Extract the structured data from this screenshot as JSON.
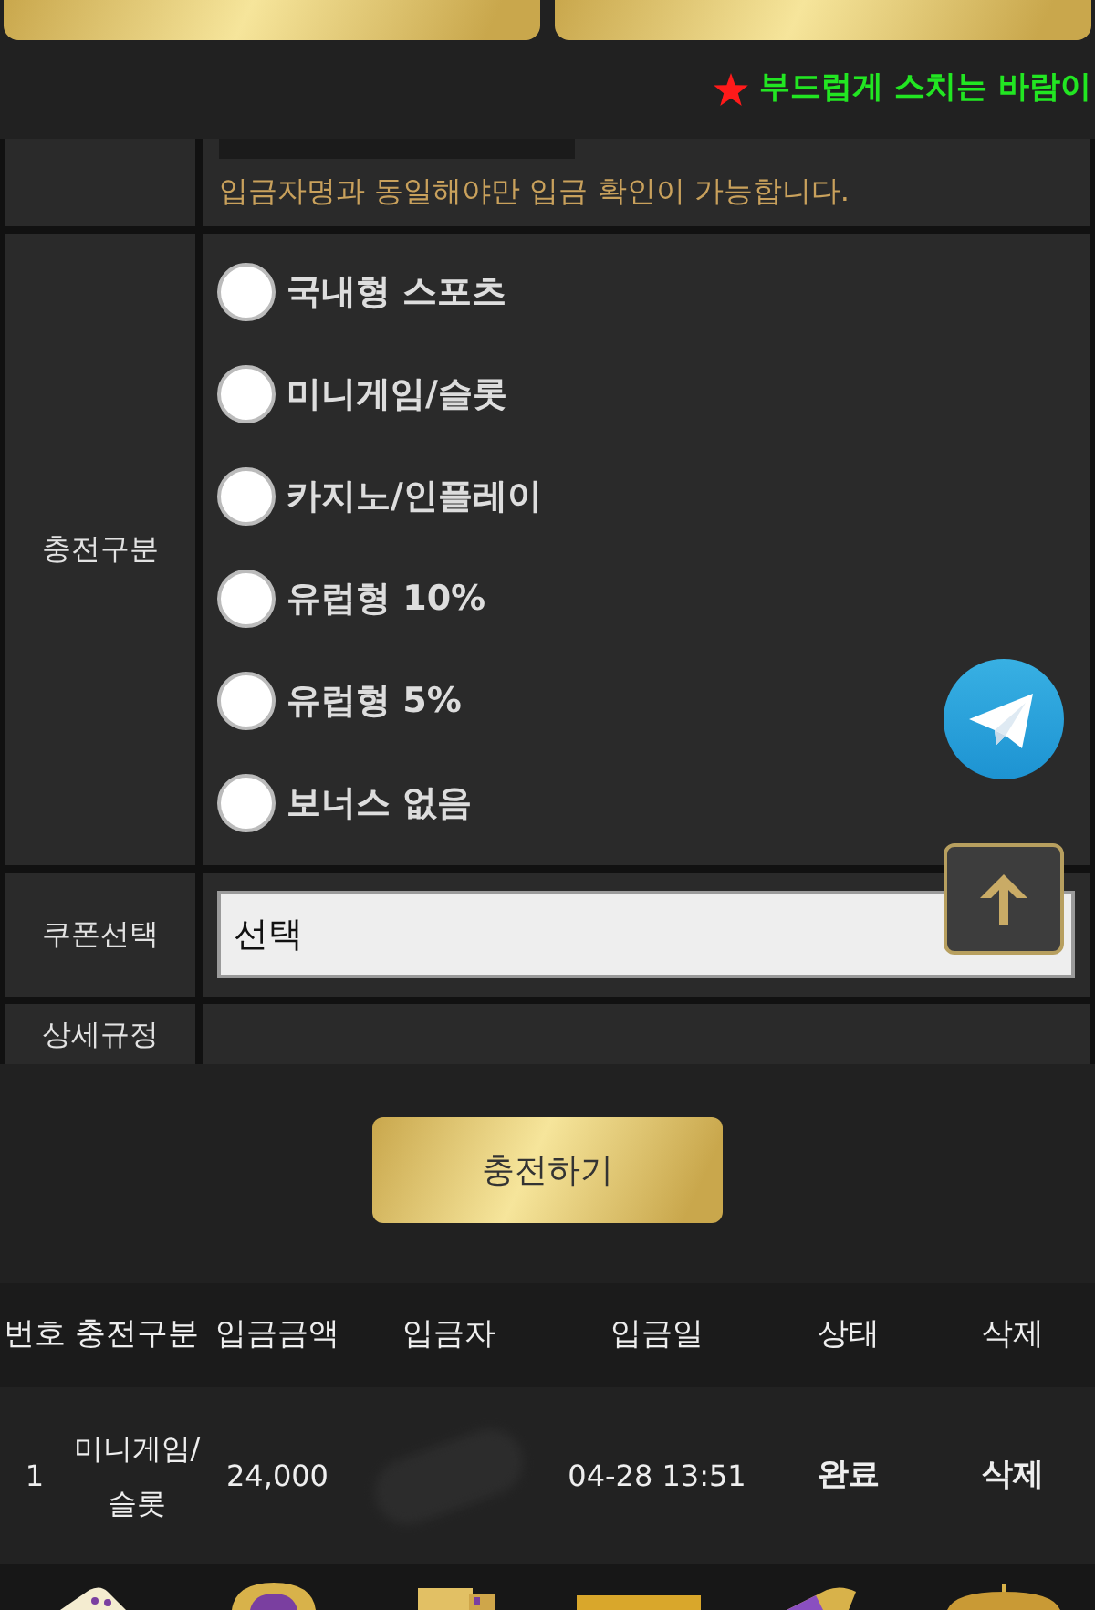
{
  "notice": {
    "text": "부드럽게 스치는 바람이"
  },
  "form": {
    "rows": [
      {
        "kind": "note",
        "note": "입금자명과 동일해야만 입금 확인이 가능합니다."
      },
      {
        "kind": "radio",
        "label": "충전구분",
        "options": [
          {
            "label": "국내형 스포츠",
            "selected": false
          },
          {
            "label": "미니게임/슬롯",
            "selected": false
          },
          {
            "label": "카지노/인플레이",
            "selected": false
          },
          {
            "label": "유럽형 10%",
            "selected": false
          },
          {
            "label": "유럽형 5%",
            "selected": false
          },
          {
            "label": "보너스 없음",
            "selected": false
          }
        ]
      },
      {
        "kind": "select",
        "label": "쿠폰선택",
        "value": "선택"
      },
      {
        "kind": "text",
        "label": "상세규정"
      }
    ]
  },
  "submit_button": {
    "label": "충전하기"
  },
  "history": {
    "columns": [
      "번호",
      "충전구분",
      "입금금액",
      "입금자",
      "입금일",
      "상태",
      "삭제"
    ],
    "rows": [
      {
        "number": "1",
        "category": "미니게임/슬롯",
        "amount": "24,000",
        "depositor_blurred": true,
        "date": "04-28 13:51",
        "status": "완료",
        "delete": "삭제"
      }
    ]
  }
}
